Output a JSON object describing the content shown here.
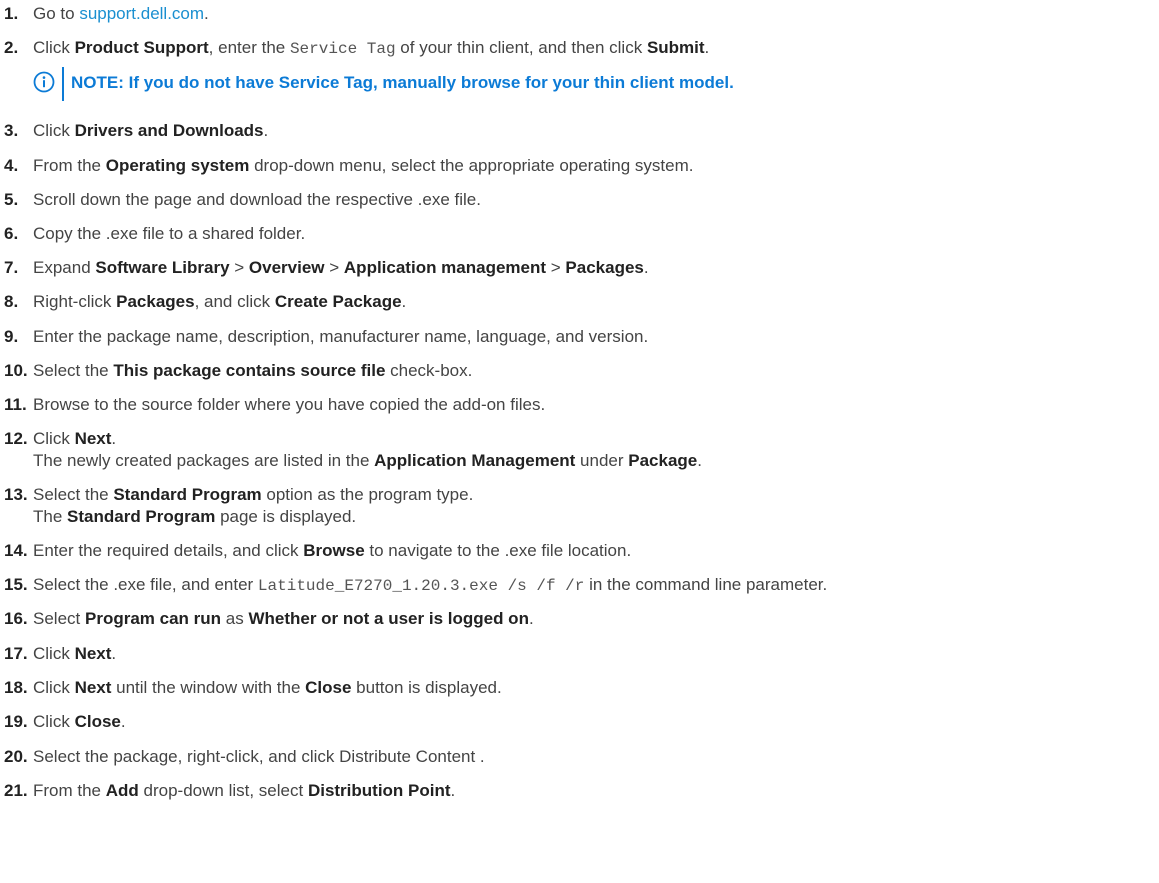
{
  "steps": [
    {
      "n": "1.",
      "a": "Go to ",
      "link": "support.dell.com",
      "b": "."
    },
    {
      "n": "2.",
      "a": "Click ",
      "b1": "Product Support",
      "c": ", enter the ",
      "mono": "Service Tag",
      "d": " of your thin client, and then click ",
      "b2": "Submit",
      "e": "."
    },
    {
      "n": "3.",
      "a": "Click ",
      "b1": "Drivers and Downloads",
      "c": "."
    },
    {
      "n": "4.",
      "a": "From the ",
      "b1": "Operating system",
      "c": " drop-down menu, select the appropriate operating system."
    },
    {
      "n": "5.",
      "a": "Scroll down the page and download the respective .exe file."
    },
    {
      "n": "6.",
      "a": "Copy the .exe file to a shared folder."
    },
    {
      "n": "7.",
      "a": "Expand ",
      "b1": "Software Library",
      "s1": " > ",
      "b2": "Overview",
      "s2": " > ",
      "b3": "Application management",
      "s3": " > ",
      "b4": "Packages",
      "e": "."
    },
    {
      "n": "8.",
      "a": "Right-click ",
      "b1": "Packages",
      "c": ", and click ",
      "b2": "Create Package",
      "e": "."
    },
    {
      "n": "9.",
      "a": "Enter the package name, description, manufacturer name, language, and version."
    },
    {
      "n": "10.",
      "a": "Select the ",
      "b1": "This package contains source file",
      "c": " check-box."
    },
    {
      "n": "11.",
      "a": "Browse to the source folder where you have copied the add-on files."
    },
    {
      "n": "12.",
      "a": "Click ",
      "b1": "Next",
      "c": ".",
      "r1": "The newly created packages are listed in the ",
      "rb1": "Application Management",
      "r2": " under ",
      "rb2": "Package",
      "r3": "."
    },
    {
      "n": "13.",
      "a": "Select the ",
      "b1": "Standard Program",
      "c": " option as the program type.",
      "r1": "The ",
      "rb1": "Standard Program",
      "r2": " page is displayed."
    },
    {
      "n": "14.",
      "a": "Enter the required details, and click ",
      "b1": "Browse",
      "c": " to navigate to the .exe file location."
    },
    {
      "n": "15.",
      "a": "Select the .exe file, and enter ",
      "mono": "Latitude_E7270_1.20.3.exe /s /f /r",
      "c": " in the command line parameter."
    },
    {
      "n": "16.",
      "a": "Select ",
      "b1": "Program can run",
      "c": " as ",
      "b2": "Whether or not a user is logged on",
      "e": "."
    },
    {
      "n": "17.",
      "a": "Click ",
      "b1": "Next",
      "c": "."
    },
    {
      "n": "18.",
      "a": "Click ",
      "b1": "Next",
      "c": " until the window with the ",
      "b2": "Close",
      "d": " button is displayed."
    },
    {
      "n": "19.",
      "a": "Click ",
      "b1": "Close",
      "c": "."
    },
    {
      "n": "20.",
      "a": "Select the package, right-click, and click Distribute Content ."
    },
    {
      "n": "21.",
      "a": "From the ",
      "b1": "Add",
      "c": " drop-down list, select ",
      "b2": "Distribution Point",
      "e": "."
    }
  ],
  "note": {
    "icon": "info-icon",
    "label": "NOTE:",
    "text": " If you do not have Service Tag, manually browse for your thin client model."
  },
  "colors": {
    "accent": "#0c7bd6",
    "link": "#1a8fd0",
    "text": "#444444"
  }
}
